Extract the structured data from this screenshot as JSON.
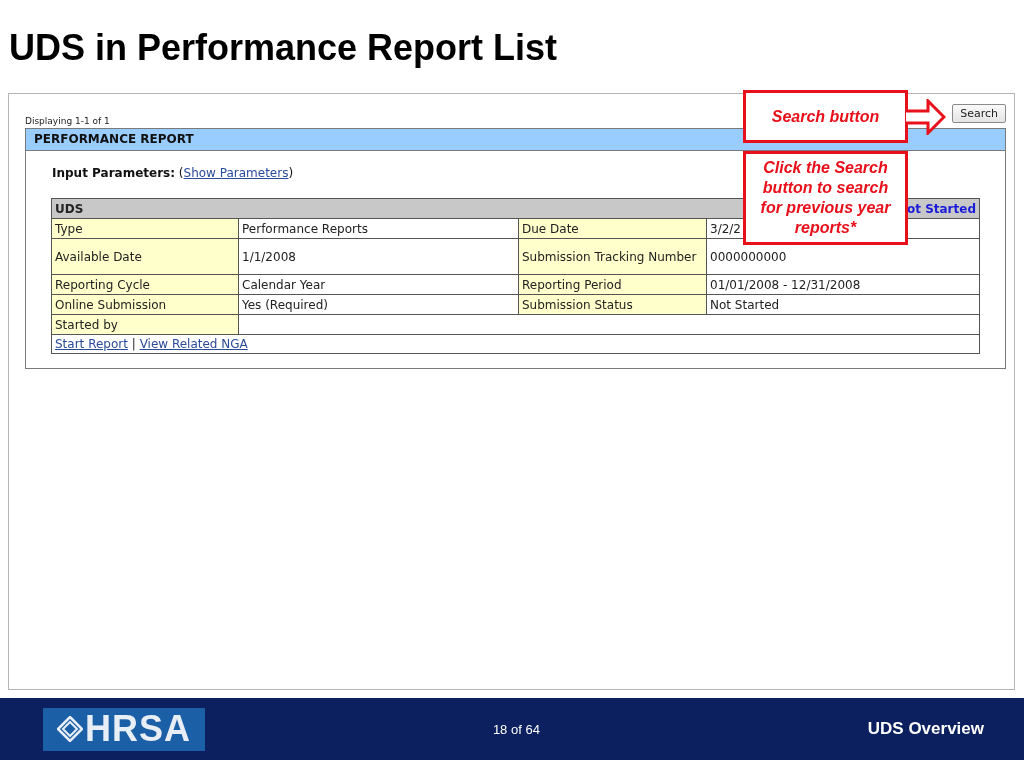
{
  "slide": {
    "title": "UDS in Performance Report List",
    "logo": "HRSA",
    "page": "18 of 64",
    "footer_title": "UDS Overview"
  },
  "screen": {
    "count": "Displaying 1-1 of 1",
    "search_button": "Search",
    "panel_title": "PERFORMANCE REPORT",
    "params_label": "Input Parameters:",
    "params_before": "(",
    "params_link": "Show Parameters",
    "params_after": ")",
    "table": {
      "title": "UDS",
      "status": "ot Started",
      "rows": [
        {
          "label": "Type",
          "value": "Performance Reports",
          "label2": "Due Date",
          "value2": "3/2/2"
        },
        {
          "label": "Available Date",
          "value": "1/1/2008",
          "label2": "Submission Tracking Number",
          "value2": "0000000000"
        },
        {
          "label": "Reporting Cycle",
          "value": "Calendar Year",
          "label2": "Reporting Period",
          "value2": "01/01/2008 - 12/31/2008"
        },
        {
          "label": "Online Submission",
          "value": "Yes (Required)",
          "label2": "Submission Status",
          "value2": "Not Started"
        },
        {
          "label": "Started by"
        }
      ],
      "links": [
        "Start Report",
        "View Related NGA"
      ],
      "link_separator": "|"
    }
  },
  "callouts": [
    {
      "kind": "arrow",
      "text": "Search button"
    },
    {
      "kind": "note",
      "text": "Click the Search button to search for previous year reports*"
    }
  ]
}
